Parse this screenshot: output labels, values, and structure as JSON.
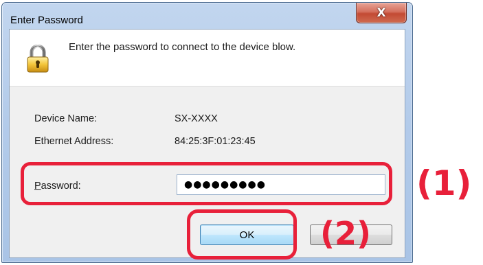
{
  "window": {
    "title": "Enter Password",
    "close_glyph": "X"
  },
  "header": {
    "icon": "lock-icon",
    "message": "Enter the password to connect to the device blow."
  },
  "device_info": [
    {
      "label": "Device Name:",
      "value": "SX-XXXX"
    },
    {
      "label": "Ethernet Address:",
      "value": "84:25:3F:01:23:45"
    }
  ],
  "password": {
    "label_mnemonic": "P",
    "label_rest": "assword:",
    "masked_value": "●●●●●●●●●"
  },
  "buttons": {
    "ok_label": "OK",
    "cancel_label": ""
  },
  "annotations": {
    "marker_1": "(1)",
    "marker_2": "(2)",
    "color": "#e8203a"
  }
}
